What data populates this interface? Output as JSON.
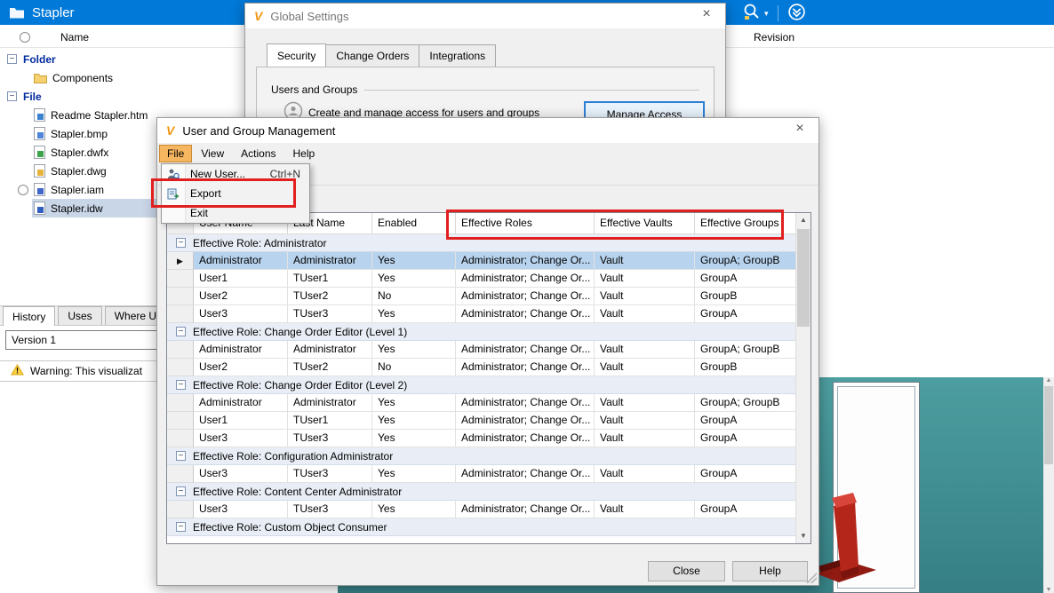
{
  "colors": {
    "titlebar": "#0079d8",
    "accent_blue": "#2e7fd4",
    "annotation_red": "#e21f1f",
    "selected_row": "#b8d3ee",
    "menu_highlight": "#f5b65f",
    "viewport_teal": "#3f8f93"
  },
  "main": {
    "title": "Stapler",
    "columns": {
      "name": "Name",
      "revision": "Revision"
    },
    "tree": [
      {
        "label": "Folder",
        "type": "branch"
      },
      {
        "label": "Components",
        "type": "folder"
      },
      {
        "label": "File",
        "type": "branch"
      },
      {
        "label": "Readme Stapler.htm",
        "type": "htm"
      },
      {
        "label": "Stapler.bmp",
        "type": "bmp"
      },
      {
        "label": "Stapler.dwfx",
        "type": "dwfx"
      },
      {
        "label": "Stapler.dwg",
        "type": "dwg"
      },
      {
        "label": "Stapler.iam",
        "type": "iam",
        "radio": true
      },
      {
        "label": "Stapler.idw",
        "type": "idw",
        "selected": true
      }
    ],
    "bottom_tabs": [
      "History",
      "Uses",
      "Where Use"
    ],
    "version": "Version 1",
    "warning": "Warning: This visualizat"
  },
  "global_settings": {
    "title": "Global Settings",
    "tabs": [
      "Security",
      "Change Orders",
      "Integrations"
    ],
    "section": "Users and Groups",
    "description": "Create and manage access for users and groups",
    "manage_access": "Manage Access"
  },
  "ugm": {
    "title": "User and Group Management",
    "menus": [
      "File",
      "View",
      "Actions",
      "Help"
    ],
    "file_menu": {
      "new_user": "New User...",
      "new_user_shortcut": "Ctrl+N",
      "export": "Export",
      "exit": "Exit"
    },
    "table": {
      "headers": [
        "User Name",
        "Last Name",
        "Enabled",
        "Effective Roles",
        "Effective Vaults",
        "Effective Groups"
      ],
      "groups": [
        {
          "title": "Effective Role: Administrator",
          "rows": [
            {
              "user": "Administrator",
              "last": "Administrator",
              "enabled": "Yes",
              "roles": "Administrator; Change Or...",
              "vaults": "Vault",
              "groups": "GroupA; GroupB",
              "selected": true
            },
            {
              "user": "User1",
              "last": "TUser1",
              "enabled": "Yes",
              "roles": "Administrator; Change Or...",
              "vaults": "Vault",
              "groups": "GroupA"
            },
            {
              "user": "User2",
              "last": "TUser2",
              "enabled": "No",
              "roles": "Administrator; Change Or...",
              "vaults": "Vault",
              "groups": "GroupB"
            },
            {
              "user": "User3",
              "last": "TUser3",
              "enabled": "Yes",
              "roles": "Administrator; Change Or...",
              "vaults": "Vault",
              "groups": "GroupA"
            }
          ]
        },
        {
          "title": "Effective Role: Change Order Editor (Level 1)",
          "rows": [
            {
              "user": "Administrator",
              "last": "Administrator",
              "enabled": "Yes",
              "roles": "Administrator; Change Or...",
              "vaults": "Vault",
              "groups": "GroupA; GroupB"
            },
            {
              "user": "User2",
              "last": "TUser2",
              "enabled": "No",
              "roles": "Administrator; Change Or...",
              "vaults": "Vault",
              "groups": "GroupB"
            }
          ]
        },
        {
          "title": "Effective Role: Change Order Editor (Level 2)",
          "rows": [
            {
              "user": "Administrator",
              "last": "Administrator",
              "enabled": "Yes",
              "roles": "Administrator; Change Or...",
              "vaults": "Vault",
              "groups": "GroupA; GroupB"
            },
            {
              "user": "User1",
              "last": "TUser1",
              "enabled": "Yes",
              "roles": "Administrator; Change Or...",
              "vaults": "Vault",
              "groups": "GroupA"
            },
            {
              "user": "User3",
              "last": "TUser3",
              "enabled": "Yes",
              "roles": "Administrator; Change Or...",
              "vaults": "Vault",
              "groups": "GroupA"
            }
          ]
        },
        {
          "title": "Effective Role: Configuration Administrator",
          "rows": [
            {
              "user": "User3",
              "last": "TUser3",
              "enabled": "Yes",
              "roles": "Administrator; Change Or...",
              "vaults": "Vault",
              "groups": "GroupA"
            }
          ]
        },
        {
          "title": "Effective Role: Content Center Administrator",
          "rows": [
            {
              "user": "User3",
              "last": "TUser3",
              "enabled": "Yes",
              "roles": "Administrator; Change Or...",
              "vaults": "Vault",
              "groups": "GroupA"
            }
          ]
        },
        {
          "title": "Effective Role: Custom Object Consumer",
          "rows": []
        }
      ]
    },
    "close": "Close",
    "help": "Help"
  }
}
